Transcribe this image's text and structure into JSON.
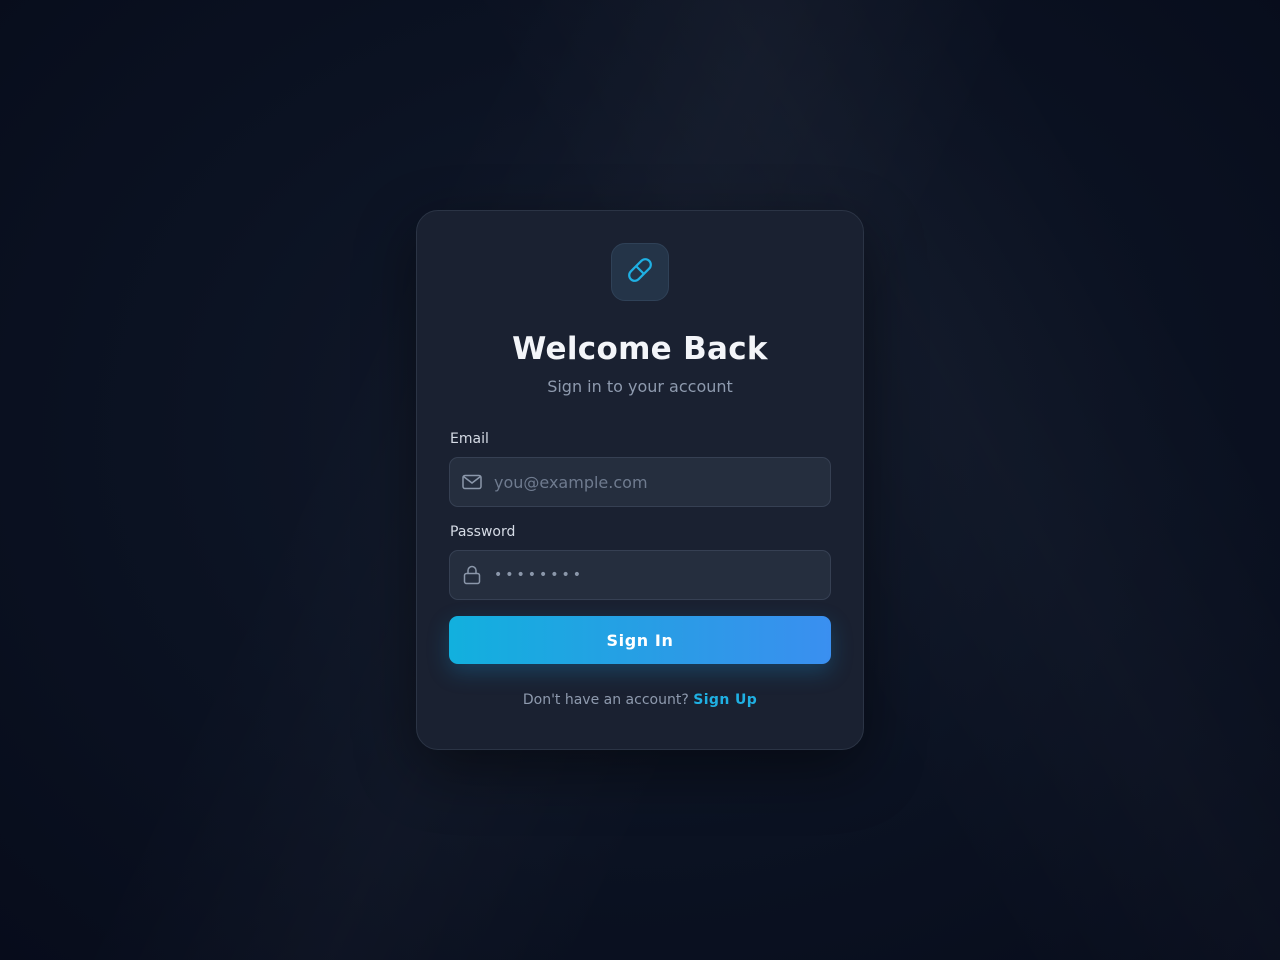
{
  "app": {
    "title": "Welcome Back",
    "subtitle": "Sign in to your account",
    "logo_icon": "pill-icon",
    "accent_color": "#1fb0e3"
  },
  "form": {
    "email": {
      "label": "Email",
      "placeholder": "you@example.com",
      "value": "",
      "icon": "mail-icon"
    },
    "password": {
      "label": "Password",
      "value": "••••••••",
      "icon": "lock-icon"
    },
    "submit_label": "Sign In"
  },
  "footer": {
    "prompt": "Don't have an account?",
    "link_label": "Sign Up"
  }
}
